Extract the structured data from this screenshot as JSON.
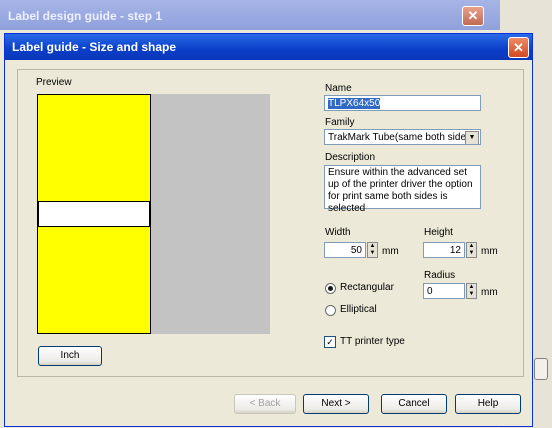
{
  "background_window": {
    "title": "Label design guide - step 1",
    "close_glyph": "✕"
  },
  "dialog": {
    "title": "Label guide - Size and shape",
    "close_glyph": "✕"
  },
  "preview": {
    "label": "Preview",
    "label_color": "#ffff00",
    "band_color": "#ffffff",
    "background_color": "#c3c3c3"
  },
  "form": {
    "name_label": "Name",
    "name_value": "TLPX64x50",
    "family_label": "Family",
    "family_value": "TrakMark Tube(same both sides",
    "description_label": "Description",
    "description_value": "Ensure within the advanced set up of the printer driver the option for print same both sides is selected",
    "width_label": "Width",
    "width_value": "50",
    "width_unit": "mm",
    "height_label": "Height",
    "height_value": "12",
    "height_unit": "mm",
    "radius_label": "Radius",
    "radius_value": "0",
    "radius_unit": "mm",
    "shape_rectangular": "Rectangular",
    "shape_elliptical": "Elliptical",
    "shape_selected": "Rectangular",
    "tt_printer_label": "TT printer type",
    "tt_printer_checked": true
  },
  "buttons": {
    "inch": "Inch",
    "back": "< Back",
    "next": "Next >",
    "cancel": "Cancel",
    "help": "Help"
  }
}
